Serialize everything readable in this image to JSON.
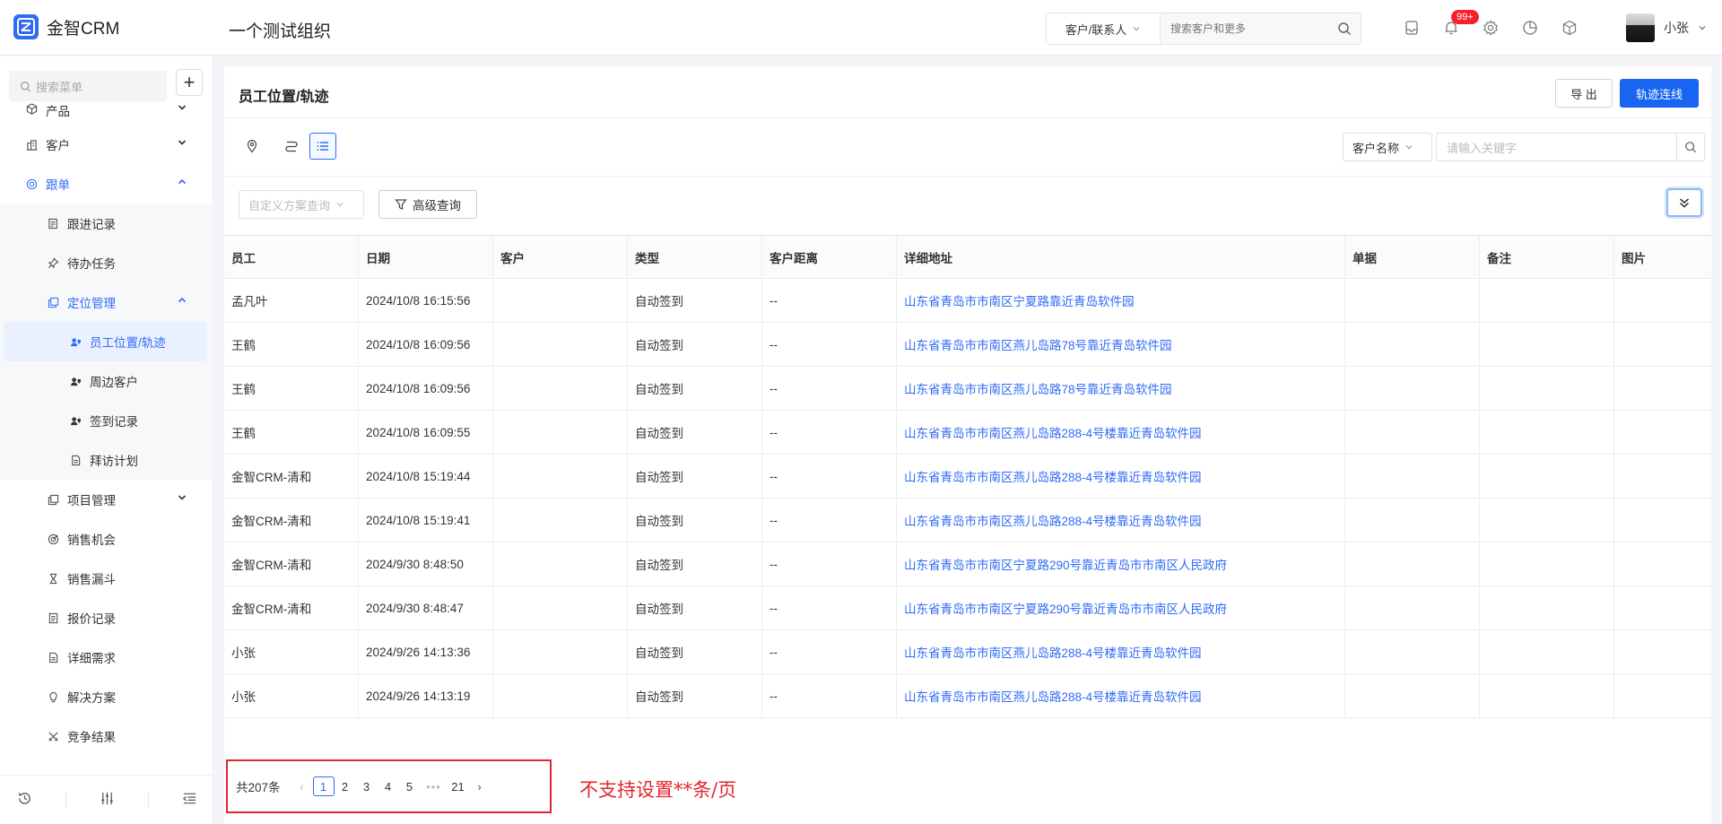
{
  "app": {
    "logo_text": "金智CRM",
    "org_name": "一个测试组织"
  },
  "topbar": {
    "search_scope": "客户/联系人",
    "search_placeholder": "搜索客户和更多",
    "notification_badge": "99+",
    "user_name": "小张"
  },
  "sidebar": {
    "search_placeholder": "搜索菜单",
    "items": [
      {
        "label": "产品",
        "icon": "cube-icon",
        "level": 1,
        "expanded": false
      },
      {
        "label": "客户",
        "icon": "building-icon",
        "level": 1,
        "expanded": false
      },
      {
        "label": "跟单",
        "icon": "target-icon",
        "level": 1,
        "expanded": true
      },
      {
        "label": "跟进记录",
        "icon": "note-icon",
        "level": 2
      },
      {
        "label": "待办任务",
        "icon": "pin-icon",
        "level": 2
      },
      {
        "label": "定位管理",
        "icon": "copy-icon",
        "level": 2,
        "expanded": true
      },
      {
        "label": "员工位置/轨迹",
        "icon": "person-location-icon",
        "level": 3,
        "active": true
      },
      {
        "label": "周边客户",
        "icon": "person-location-icon",
        "level": 3
      },
      {
        "label": "签到记录",
        "icon": "person-location-icon",
        "level": 3
      },
      {
        "label": "拜访计划",
        "icon": "document-icon",
        "level": 3
      },
      {
        "label": "项目管理",
        "icon": "copy-icon",
        "level": 2,
        "expanded": false
      },
      {
        "label": "销售机会",
        "icon": "target-icon",
        "level": 2
      },
      {
        "label": "销售漏斗",
        "icon": "hourglass-icon",
        "level": 2
      },
      {
        "label": "报价记录",
        "icon": "document-icon",
        "level": 2
      },
      {
        "label": "详细需求",
        "icon": "document-icon",
        "level": 2
      },
      {
        "label": "解决方案",
        "icon": "bulb-icon",
        "level": 2
      },
      {
        "label": "竞争结果",
        "icon": "swords-icon",
        "level": 2
      }
    ]
  },
  "main": {
    "title": "员工位置/轨迹",
    "export_label": "导 出",
    "track_label": "轨迹连线",
    "field_select": "客户名称",
    "keyword_placeholder": "请输入关键字",
    "custom_query_placeholder": "自定义方案查询",
    "advanced_query_label": "高级查询",
    "columns": [
      "员工",
      "日期",
      "客户",
      "类型",
      "客户距离",
      "详细地址",
      "单据",
      "备注",
      "图片"
    ],
    "rows": [
      [
        "孟凡叶",
        "2024/10/8 16:15:56",
        "",
        "自动签到",
        "--",
        "山东省青岛市市南区宁夏路靠近青岛软件园",
        "",
        "",
        ""
      ],
      [
        "王鹤",
        "2024/10/8 16:09:56",
        "",
        "自动签到",
        "--",
        "山东省青岛市市南区燕儿岛路78号靠近青岛软件园",
        "",
        "",
        ""
      ],
      [
        "王鹤",
        "2024/10/8 16:09:56",
        "",
        "自动签到",
        "--",
        "山东省青岛市市南区燕儿岛路78号靠近青岛软件园",
        "",
        "",
        ""
      ],
      [
        "王鹤",
        "2024/10/8 16:09:55",
        "",
        "自动签到",
        "--",
        "山东省青岛市市南区燕儿岛路288-4号楼靠近青岛软件园",
        "",
        "",
        ""
      ],
      [
        "金智CRM-清和",
        "2024/10/8 15:19:44",
        "",
        "自动签到",
        "--",
        "山东省青岛市市南区燕儿岛路288-4号楼靠近青岛软件园",
        "",
        "",
        ""
      ],
      [
        "金智CRM-清和",
        "2024/10/8 15:19:41",
        "",
        "自动签到",
        "--",
        "山东省青岛市市南区燕儿岛路288-4号楼靠近青岛软件园",
        "",
        "",
        ""
      ],
      [
        "金智CRM-清和",
        "2024/9/30 8:48:50",
        "",
        "自动签到",
        "--",
        "山东省青岛市市南区宁夏路290号靠近青岛市市南区人民政府",
        "",
        "",
        ""
      ],
      [
        "金智CRM-清和",
        "2024/9/30 8:48:47",
        "",
        "自动签到",
        "--",
        "山东省青岛市市南区宁夏路290号靠近青岛市市南区人民政府",
        "",
        "",
        ""
      ],
      [
        "小张",
        "2024/9/26 14:13:36",
        "",
        "自动签到",
        "--",
        "山东省青岛市市南区燕儿岛路288-4号楼靠近青岛软件园",
        "",
        "",
        ""
      ],
      [
        "小张",
        "2024/9/26 14:13:19",
        "",
        "自动签到",
        "--",
        "山东省青岛市市南区燕儿岛路288-4号楼靠近青岛软件园",
        "",
        "",
        ""
      ]
    ],
    "pagination": {
      "total": "共207条",
      "pages": [
        "1",
        "2",
        "3",
        "4",
        "5"
      ],
      "ellipsis": "•••",
      "last": "21",
      "current": "1"
    },
    "annotation": "不支持设置**条/页"
  },
  "colors": {
    "accent": "#2f6bf5",
    "primary_button": "#1865f2",
    "annotation_red": "#e0262e",
    "badge_red": "#f5222d"
  }
}
